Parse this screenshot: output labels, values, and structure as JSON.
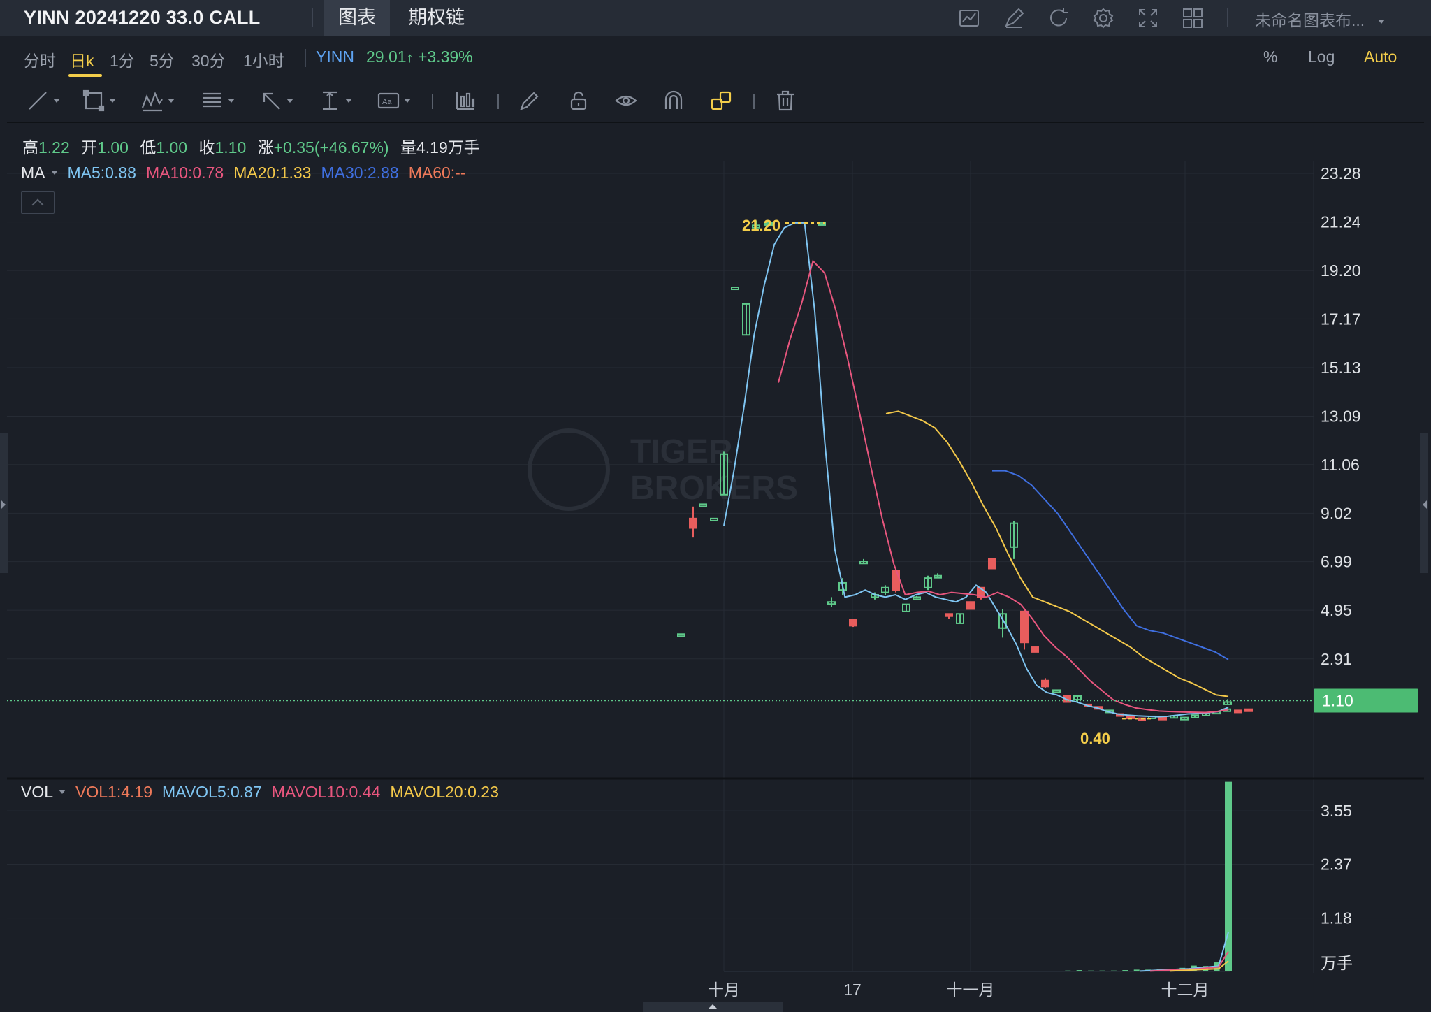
{
  "header": {
    "title": "YINN 20241220 33.0 CALL",
    "tabs": [
      {
        "label": "图表",
        "active": true
      },
      {
        "label": "期权链",
        "active": false
      }
    ],
    "icons": [
      "indicator-icon",
      "draw-icon",
      "refresh-icon",
      "settings-icon",
      "fullscreen-icon",
      "layout-grid-icon"
    ],
    "layout_name": "未命名图表布..."
  },
  "periods": [
    {
      "label": "分时",
      "active": false
    },
    {
      "label": "日k",
      "active": true
    },
    {
      "label": "1分",
      "active": false
    },
    {
      "label": "5分",
      "active": false
    },
    {
      "label": "30分",
      "active": false
    },
    {
      "label": "1小时",
      "active": false
    }
  ],
  "underlying": {
    "ticker": "YINN",
    "quote": "29.01",
    "change": "+3.39%"
  },
  "scale_options": {
    "percent": "%",
    "log": "Log",
    "auto": "Auto"
  },
  "drawing_tools": [
    "line-tool-icon",
    "rect-tool-icon",
    "pattern-tool-icon",
    "fib-tool-icon",
    "arrow-tool-icon",
    "measure-tool-icon",
    "text-tool-icon",
    "bar-type-icon",
    "pencil-icon",
    "unlock-icon",
    "eye-icon",
    "magnet-icon",
    "link-icon",
    "trash-icon"
  ],
  "ohlc": {
    "high_label": "高",
    "high": "1.22",
    "open_label": "开",
    "open": "1.00",
    "low_label": "低",
    "low": "1.00",
    "close_label": "收",
    "close": "1.10",
    "change_label": "涨",
    "change": "+0.35(+46.67%)",
    "volume_label": "量",
    "volume": "4.19",
    "volume_unit": "万手"
  },
  "ma_legend": {
    "name": "MA",
    "items": [
      {
        "text": "MA5:0.88",
        "color": "#7fc5f2"
      },
      {
        "text": "MA10:0.78",
        "color": "#e8567e"
      },
      {
        "text": "MA20:1.33",
        "color": "#f3c84a"
      },
      {
        "text": "MA30:2.88",
        "color": "#3f6fe0"
      },
      {
        "text": "MA60:--",
        "color": "#ef7a5a"
      }
    ]
  },
  "vol_legend": {
    "name": "VOL",
    "items": [
      {
        "text": "VOL1:4.19",
        "color": "#ef7a5a"
      },
      {
        "text": "MAVOL5:0.87",
        "color": "#7fc5f2"
      },
      {
        "text": "MAVOL10:0.44",
        "color": "#e8567e"
      },
      {
        "text": "MAVOL20:0.23",
        "color": "#f3c84a"
      }
    ]
  },
  "watermark": {
    "line1": "TIGER",
    "line2": "BROKERS"
  },
  "colors": {
    "up": "#5fc98a",
    "down": "#e85d5d",
    "accent": "#f3cd4a",
    "background": "#1b1f27"
  },
  "chart_data": [
    {
      "type": "candlestick",
      "title": "YINN 20241220 33.0 CALL",
      "y_ticks": [
        "23.28",
        "21.24",
        "19.20",
        "17.17",
        "15.13",
        "13.09",
        "11.06",
        "9.02",
        "6.99",
        "4.95",
        "2.91"
      ],
      "ylim": [
        0.0,
        23.28
      ],
      "x_ticks": [
        "十月",
        "17",
        "十一月",
        "十二月"
      ],
      "last_price": "1.10",
      "high_marker": "21.20",
      "low_marker": "0.40",
      "candles": [
        {
          "o": 3.95,
          "h": 3.95,
          "l": 3.95,
          "c": 3.95
        },
        {
          "o": 8.8,
          "h": 9.3,
          "l": 8.0,
          "c": 8.4
        },
        {
          "o": 9.4,
          "h": 9.4,
          "l": 9.4,
          "c": 9.4
        },
        {
          "o": 8.8,
          "h": 8.8,
          "l": 8.8,
          "c": 8.8
        },
        {
          "o": 9.8,
          "h": 11.6,
          "l": 9.8,
          "c": 11.5
        },
        {
          "o": 18.5,
          "h": 18.5,
          "l": 18.5,
          "c": 18.5
        },
        {
          "o": 16.5,
          "h": 17.8,
          "l": 16.5,
          "c": 17.8
        },
        {
          "o": 21.0,
          "h": 21.3,
          "l": 20.9,
          "c": 21.1
        },
        {
          "o": 21.2,
          "h": 21.2,
          "l": 21.2,
          "c": 21.2
        },
        {
          "o": 21.2,
          "h": 21.2,
          "l": 21.2,
          "c": 21.2
        },
        {
          "o": 5.3,
          "h": 5.5,
          "l": 5.1,
          "c": 5.3
        },
        {
          "o": 5.8,
          "h": 6.3,
          "l": 5.6,
          "c": 6.1
        },
        {
          "o": 4.55,
          "h": 4.55,
          "l": 4.25,
          "c": 4.3
        },
        {
          "o": 6.95,
          "h": 7.1,
          "l": 6.9,
          "c": 7.0
        },
        {
          "o": 5.5,
          "h": 5.7,
          "l": 5.4,
          "c": 5.6
        },
        {
          "o": 5.7,
          "h": 6.0,
          "l": 5.6,
          "c": 5.9
        },
        {
          "o": 6.6,
          "h": 6.6,
          "l": 5.7,
          "c": 5.8
        },
        {
          "o": 4.9,
          "h": 5.2,
          "l": 4.9,
          "c": 5.2
        },
        {
          "o": 5.5,
          "h": 5.55,
          "l": 5.45,
          "c": 5.5
        },
        {
          "o": 5.9,
          "h": 6.4,
          "l": 5.8,
          "c": 6.3
        },
        {
          "o": 6.4,
          "h": 6.5,
          "l": 6.35,
          "c": 6.4
        },
        {
          "o": 4.8,
          "h": 4.8,
          "l": 4.6,
          "c": 4.7
        },
        {
          "o": 4.4,
          "h": 4.8,
          "l": 4.4,
          "c": 4.8
        },
        {
          "o": 5.3,
          "h": 5.3,
          "l": 5.0,
          "c": 5.0
        },
        {
          "o": 5.9,
          "h": 5.9,
          "l": 5.4,
          "c": 5.5
        },
        {
          "o": 7.1,
          "h": 7.1,
          "l": 6.7,
          "c": 6.7
        },
        {
          "o": 4.2,
          "h": 5.0,
          "l": 3.8,
          "c": 4.8
        },
        {
          "o": 7.6,
          "h": 8.7,
          "l": 7.1,
          "c": 8.6
        },
        {
          "o": 4.9,
          "h": 5.0,
          "l": 3.3,
          "c": 3.6
        },
        {
          "o": 3.4,
          "h": 3.4,
          "l": 3.2,
          "c": 3.2
        },
        {
          "o": 2.0,
          "h": 2.1,
          "l": 1.7,
          "c": 1.75
        },
        {
          "o": 1.6,
          "h": 1.6,
          "l": 1.6,
          "c": 1.6
        },
        {
          "o": 1.35,
          "h": 1.35,
          "l": 1.1,
          "c": 1.1
        },
        {
          "o": 1.2,
          "h": 1.4,
          "l": 1.1,
          "c": 1.35
        },
        {
          "o": 1.0,
          "h": 1.0,
          "l": 0.95,
          "c": 0.95
        },
        {
          "o": 0.9,
          "h": 0.9,
          "l": 0.85,
          "c": 0.85
        },
        {
          "o": 0.75,
          "h": 0.75,
          "l": 0.75,
          "c": 0.75
        },
        {
          "o": 0.6,
          "h": 0.6,
          "l": 0.55,
          "c": 0.55
        },
        {
          "o": 0.5,
          "h": 0.5,
          "l": 0.45,
          "c": 0.45
        },
        {
          "o": 0.42,
          "h": 0.42,
          "l": 0.4,
          "c": 0.4
        },
        {
          "o": 0.5,
          "h": 0.52,
          "l": 0.48,
          "c": 0.5
        },
        {
          "o": 0.45,
          "h": 0.45,
          "l": 0.42,
          "c": 0.42
        },
        {
          "o": 0.5,
          "h": 0.55,
          "l": 0.45,
          "c": 0.52
        },
        {
          "o": 0.4,
          "h": 0.45,
          "l": 0.4,
          "c": 0.45
        },
        {
          "o": 0.45,
          "h": 0.55,
          "l": 0.45,
          "c": 0.55
        },
        {
          "o": 0.55,
          "h": 0.65,
          "l": 0.5,
          "c": 0.62
        },
        {
          "o": 0.7,
          "h": 0.7,
          "l": 0.7,
          "c": 0.7
        },
        {
          "o": 0.75,
          "h": 0.8,
          "l": 0.7,
          "c": 0.8
        },
        {
          "o": 0.75,
          "h": 0.75,
          "l": 0.7,
          "c": 0.72
        },
        {
          "o": 0.8,
          "h": 0.8,
          "l": 0.75,
          "c": 0.75
        },
        {
          "o": 1.0,
          "h": 1.22,
          "l": 1.0,
          "c": 1.1
        }
      ],
      "ma_series": [
        {
          "name": "MA5",
          "color": "#7fc5f2",
          "values": [
            8.5,
            10.8,
            13.5,
            16.5,
            18.6,
            20.3,
            21.0,
            21.2,
            21.2,
            17.5,
            12.0,
            7.5,
            5.5,
            5.6,
            5.8,
            5.6,
            5.5,
            5.6,
            5.4,
            5.6,
            5.7,
            5.5,
            5.4,
            5.3,
            5.5,
            6.0,
            5.7,
            5.0,
            4.3,
            3.5,
            2.5,
            1.8,
            1.5,
            1.4,
            1.2,
            1.1,
            0.95,
            0.85,
            0.7,
            0.6,
            0.55,
            0.52,
            0.5,
            0.48,
            0.5,
            0.55,
            0.6,
            0.62,
            0.65,
            0.7,
            0.88
          ]
        },
        {
          "name": "MA10",
          "color": "#e8567e",
          "values": [
            14.5,
            16.3,
            17.8,
            19.6,
            19.1,
            17.5,
            15.5,
            13.3,
            11.0,
            8.8,
            6.9,
            5.6,
            5.7,
            5.75,
            5.6,
            5.7,
            5.65,
            5.6,
            5.5,
            5.7,
            5.5,
            5.2,
            4.6,
            3.9,
            3.4,
            3.0,
            2.5,
            2.0,
            1.6,
            1.2,
            1.0,
            0.85,
            0.78,
            0.72,
            0.7,
            0.68,
            0.67,
            0.66,
            0.7,
            0.78
          ]
        },
        {
          "name": "MA20",
          "color": "#f3c84a",
          "values": [
            13.2,
            13.3,
            13.1,
            12.9,
            12.6,
            12.0,
            11.2,
            10.3,
            9.3,
            8.4,
            7.3,
            6.3,
            5.5,
            5.3,
            5.1,
            4.9,
            4.6,
            4.3,
            4.0,
            3.7,
            3.4,
            3.0,
            2.7,
            2.4,
            2.1,
            1.9,
            1.65,
            1.4,
            1.33
          ]
        },
        {
          "name": "MA30",
          "color": "#3f6fe0",
          "values": [
            10.8,
            10.8,
            10.6,
            10.2,
            9.6,
            9.0,
            8.2,
            7.4,
            6.6,
            5.8,
            5.0,
            4.3,
            4.1,
            4.0,
            3.8,
            3.6,
            3.4,
            3.2,
            2.88
          ]
        }
      ]
    },
    {
      "type": "bar",
      "title": "VOL",
      "unit": "万手",
      "y_ticks": [
        "3.55",
        "2.37",
        "1.18"
      ],
      "ylim": [
        0,
        4.2
      ],
      "values": [
        0.001,
        0.002,
        0.001,
        0.001,
        0.002,
        0.001,
        0.002,
        0.001,
        0.001,
        0.001,
        0.002,
        0.001,
        0.002,
        0.003,
        0.002,
        0.001,
        0.003,
        0.002,
        0.002,
        0.003,
        0.002,
        0.003,
        0.002,
        0.003,
        0.002,
        0.004,
        0.005,
        0.005,
        0.01,
        0.01,
        0.02,
        0.03,
        0.02,
        0.02,
        0.02,
        0.03,
        0.04,
        0.04,
        0.05,
        0.06,
        0.08,
        0.13,
        0.12,
        0.2,
        4.19
      ],
      "mavol_series": [
        {
          "name": "MAVOL5",
          "color": "#7fc5f2",
          "values": [
            0.01,
            0.02,
            0.03,
            0.04,
            0.05,
            0.06,
            0.08,
            0.1,
            0.12,
            0.87
          ]
        },
        {
          "name": "MAVOL10",
          "color": "#e8567e",
          "values": [
            0.01,
            0.02,
            0.03,
            0.04,
            0.05,
            0.06,
            0.08,
            0.1,
            0.44
          ]
        },
        {
          "name": "MAVOL20",
          "color": "#f3c84a",
          "values": [
            0.01,
            0.02,
            0.03,
            0.04,
            0.05,
            0.06,
            0.23
          ]
        }
      ]
    }
  ]
}
